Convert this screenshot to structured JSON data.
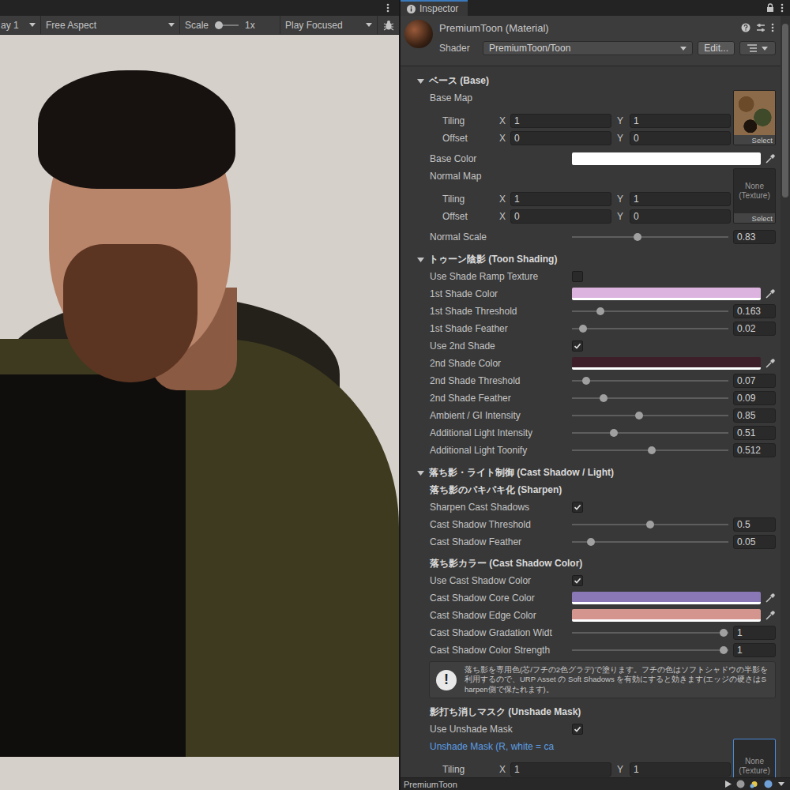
{
  "game_view": {
    "toolbar": [
      {
        "kind": "dropdown",
        "label": "ay 1"
      },
      {
        "kind": "dropdown",
        "label": "Free Aspect"
      },
      {
        "kind": "scale",
        "label": "Scale",
        "value": "1x",
        "level": 0.17
      },
      {
        "kind": "dropdown",
        "label": "Play Focused"
      }
    ]
  },
  "inspector": {
    "tab": "Inspector",
    "material": {
      "name": "PremiumToon (Material)",
      "shader_label": "Shader",
      "shader": "PremiumToon/Toon",
      "edit_button": "Edit..."
    },
    "sections": [
      {
        "title": "ベース (Base)",
        "expanded": true,
        "rows": [
          {
            "kind": "texture",
            "label": "Base Map",
            "link": false,
            "assigned": true,
            "focused": false,
            "empty_label": "",
            "select": "Select",
            "vectors": [
              {
                "label": "Tiling",
                "x_label": "X",
                "x": "1",
                "y_label": "Y",
                "y": "1"
              },
              {
                "label": "Offset",
                "x_label": "X",
                "x": "0",
                "y_label": "Y",
                "y": "0"
              }
            ]
          },
          {
            "kind": "color",
            "label": "Base Color",
            "color": "#ffffff"
          },
          {
            "kind": "texture",
            "label": "Normal Map",
            "link": false,
            "assigned": false,
            "focused": false,
            "empty_label": "None (Texture)",
            "select": "Select",
            "vectors": [
              {
                "label": "Tiling",
                "x_label": "X",
                "x": "1",
                "y_label": "Y",
                "y": "1"
              },
              {
                "label": "Offset",
                "x_label": "X",
                "x": "0",
                "y_label": "Y",
                "y": "0"
              }
            ]
          },
          {
            "kind": "slider",
            "label": "Normal Scale",
            "level": 0.42,
            "value": "0.83"
          }
        ]
      },
      {
        "title": "トゥーン陰影 (Toon Shading)",
        "expanded": true,
        "rows": [
          {
            "kind": "checkbox",
            "label": "Use Shade Ramp Texture",
            "checked": false
          },
          {
            "kind": "color",
            "label": "1st Shade Color",
            "color": "#dcb3de"
          },
          {
            "kind": "slider",
            "label": "1st Shade Threshold",
            "level": 0.18,
            "value": "0.163"
          },
          {
            "kind": "slider",
            "label": "1st Shade Feather",
            "level": 0.07,
            "value": "0.02"
          },
          {
            "kind": "checkbox",
            "label": "Use 2nd Shade",
            "checked": true
          },
          {
            "kind": "color",
            "label": "2nd Shade Color",
            "color": "#3d1f2a"
          },
          {
            "kind": "slider",
            "label": "2nd Shade Threshold",
            "level": 0.09,
            "value": "0.07"
          },
          {
            "kind": "slider",
            "label": "2nd Shade Feather",
            "level": 0.2,
            "value": "0.09"
          },
          {
            "kind": "slider",
            "label": "Ambient / GI Intensity",
            "level": 0.43,
            "value": "0.85"
          },
          {
            "kind": "slider",
            "label": "Additional Light Intensity",
            "level": 0.27,
            "value": "0.51"
          },
          {
            "kind": "slider",
            "label": "Additional Light Toonify",
            "level": 0.51,
            "value": "0.512"
          }
        ]
      },
      {
        "title": "落ち影・ライト制御 (Cast Shadow / Light)",
        "expanded": true,
        "rows": [
          {
            "kind": "subheader",
            "label": "落ち影のパキパキ化 (Sharpen)"
          },
          {
            "kind": "checkbox",
            "label": "Sharpen Cast Shadows",
            "checked": true
          },
          {
            "kind": "slider",
            "label": "Cast Shadow Threshold",
            "level": 0.5,
            "value": "0.5"
          },
          {
            "kind": "slider",
            "label": "Cast Shadow Feather",
            "level": 0.12,
            "value": "0.05"
          },
          {
            "kind": "subheader",
            "label": "落ち影カラー (Cast Shadow Color)"
          },
          {
            "kind": "checkbox",
            "label": "Use Cast Shadow Color",
            "checked": true
          },
          {
            "kind": "color",
            "label": "Cast Shadow Core Color",
            "color": "#8a78b6"
          },
          {
            "kind": "color",
            "label": "Cast Shadow Edge Color",
            "color": "#d4958f"
          },
          {
            "kind": "slider",
            "label": "Cast Shadow Gradation Widt",
            "level": 0.97,
            "value": "1"
          },
          {
            "kind": "slider",
            "label": "Cast Shadow Color Strength",
            "level": 0.97,
            "value": "1"
          },
          {
            "kind": "info",
            "icon": "!",
            "text": "落ち影を専用色(芯/フチの2色グラデ)で塗ります。フチの色はソフトシャドウの半影を利用するので、URP Asset の Soft Shadows を有効にすると効きます(エッジの硬さはSharpen側で保たれます)。"
          },
          {
            "kind": "subheader",
            "label": "影打ち消しマスク (Unshade Mask)"
          },
          {
            "kind": "checkbox",
            "label": "Use Unshade Mask",
            "checked": true
          },
          {
            "kind": "texture",
            "label": "Unshade Mask (R, white = ca",
            "link": true,
            "assigned": false,
            "focused": true,
            "empty_label": "None (Texture)",
            "select": "",
            "vectors": [
              {
                "label": "Tiling",
                "x_label": "X",
                "x": "1",
                "y_label": "Y",
                "y": "1"
              }
            ]
          }
        ]
      }
    ],
    "footer": "PremiumToon"
  }
}
